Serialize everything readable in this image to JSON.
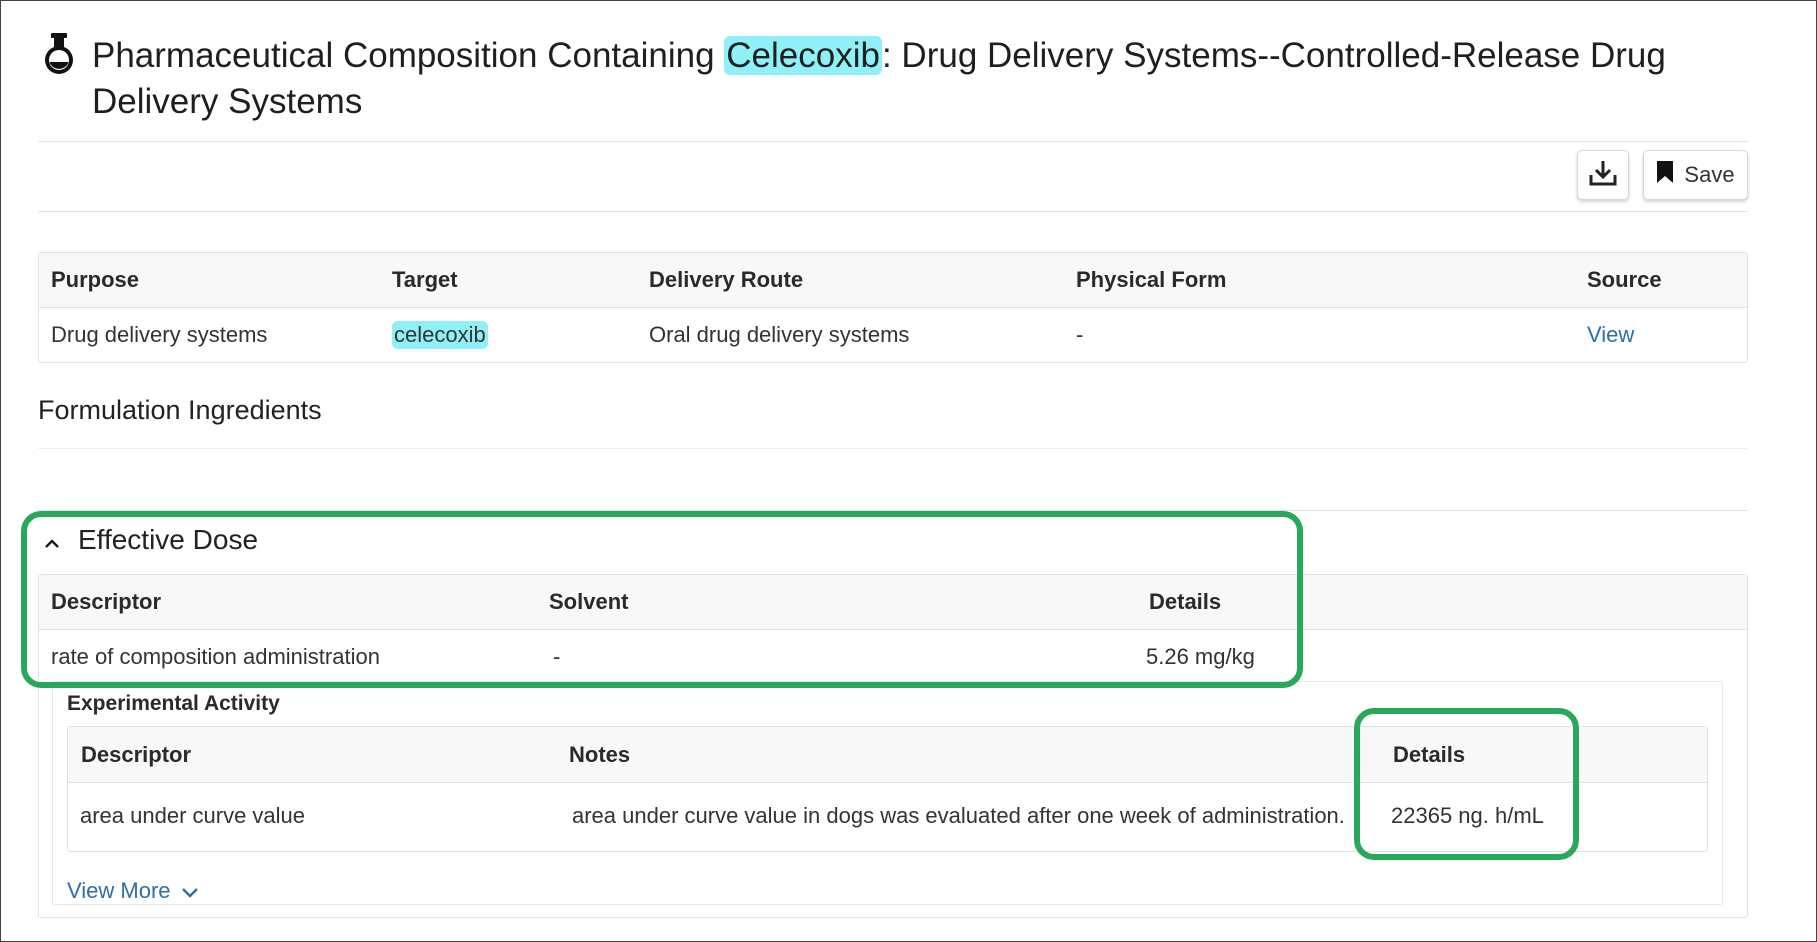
{
  "title": {
    "prefix": "Pharmaceutical Composition Containing ",
    "highlight": "Celecoxib",
    "suffix": ": Drug Delivery Systems--Controlled-Release Drug Delivery Systems",
    "icon": "flask-icon"
  },
  "toolbar": {
    "download_icon": "download-icon",
    "save_label": "Save",
    "save_icon": "bookmark-icon"
  },
  "summary_table": {
    "headers": [
      "Purpose",
      "Target",
      "Delivery Route",
      "Physical Form",
      "Source"
    ],
    "row": {
      "purpose": "Drug delivery systems",
      "target": "celecoxib",
      "delivery_route": "Oral drug delivery systems",
      "physical_form": "-",
      "source": "View"
    }
  },
  "formulation": {
    "heading": "Formulation Ingredients"
  },
  "effective_dose": {
    "heading": "Effective Dose",
    "headers": [
      "Descriptor",
      "Solvent",
      "Details"
    ],
    "row": {
      "descriptor": "rate of composition administration",
      "solvent": "-",
      "details": "5.26 mg/kg"
    }
  },
  "experimental_activity": {
    "heading": "Experimental Activity",
    "headers": [
      "Descriptor",
      "Notes",
      "Details"
    ],
    "row": {
      "descriptor": "area under curve value",
      "notes": "area under curve value in dogs was evaluated after one week of administration.",
      "details": "22365 ng. h/mL"
    },
    "view_more": "View More"
  },
  "colors": {
    "highlight": "#8ff0f8",
    "link": "#2f6fa5",
    "annotation_green": "#27a85a",
    "header_bg": "#f8f8f8",
    "border": "#e2e2e2"
  }
}
